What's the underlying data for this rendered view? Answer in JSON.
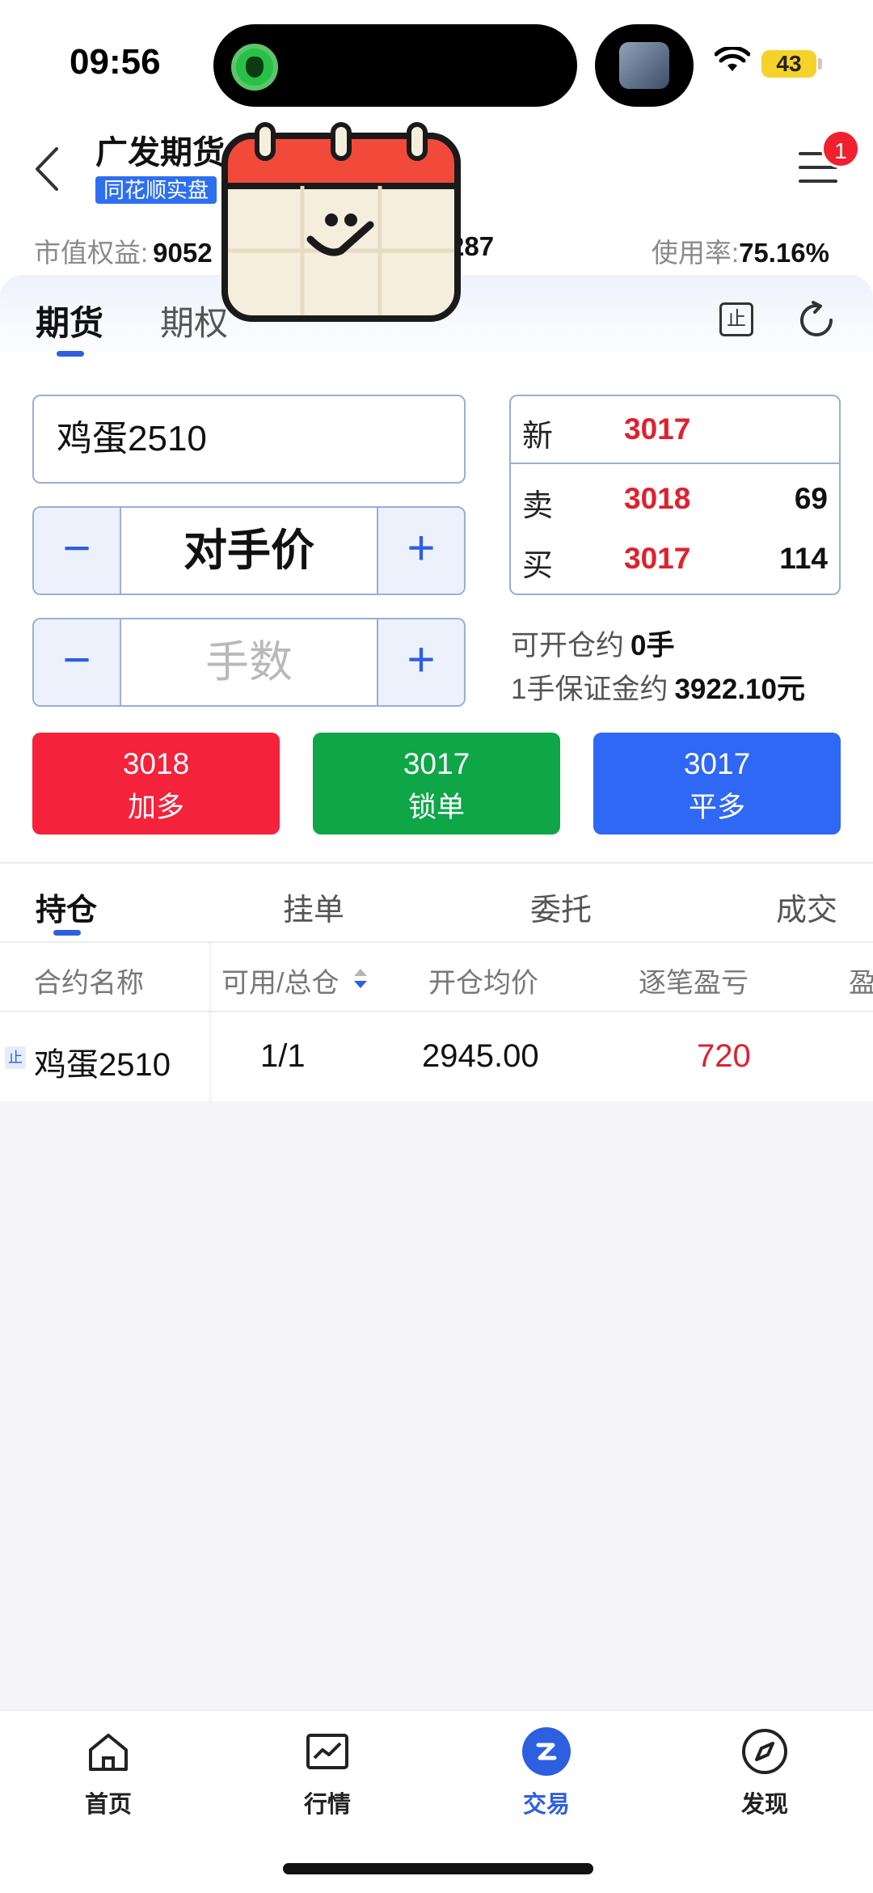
{
  "status_bar": {
    "time": "09:56",
    "battery": "43"
  },
  "header": {
    "broker": "广发期货",
    "account_badge": "同花顺实盘",
    "menu_badge": "1",
    "equity_label": "市值权益:",
    "equity_value": "9052",
    "equity_partial": "287",
    "usage_label": "使用率:",
    "usage_value": "75.16%"
  },
  "tabs": {
    "futures": "期货",
    "options": "期权",
    "stop_icon_text": "止"
  },
  "order": {
    "contract": "鸡蛋2510",
    "price_mode": "对手价",
    "qty_placeholder": "手数",
    "minus": "−",
    "plus": "+"
  },
  "quote": {
    "last_label": "新",
    "last_price": "3017",
    "ask_label": "卖",
    "ask_price": "3018",
    "ask_vol": "69",
    "bid_label": "买",
    "bid_price": "3017",
    "bid_vol": "114"
  },
  "info": {
    "open_label": "可开仓约",
    "open_value": "0手",
    "margin_label": "1手保证金约",
    "margin_value": "3922.10元"
  },
  "actions": [
    {
      "price": "3018",
      "label": "加多",
      "color": "#f5223c"
    },
    {
      "price": "3017",
      "label": "锁单",
      "color": "#0fa648"
    },
    {
      "price": "3017",
      "label": "平多",
      "color": "#2f68f4"
    }
  ],
  "position_tabs": [
    "持仓",
    "挂单",
    "委托",
    "成交"
  ],
  "table": {
    "headers": [
      "合约名称",
      "可用/总仓",
      "开仓均价",
      "逐笔盈亏",
      "盈"
    ],
    "rows": [
      {
        "tag": "止",
        "name": "鸡蛋2510",
        "avail_total": "1/1",
        "avg_price": "2945.00",
        "pnl": "720"
      }
    ]
  },
  "nav": [
    {
      "label": "首页",
      "icon": "home-icon"
    },
    {
      "label": "行情",
      "icon": "chart-icon"
    },
    {
      "label": "交易",
      "icon": "trade-icon",
      "active": true
    },
    {
      "label": "发现",
      "icon": "compass-icon"
    }
  ],
  "colors": {
    "accent": "#2e5fe0",
    "up": "#e0202e",
    "down": "#0fa648"
  }
}
